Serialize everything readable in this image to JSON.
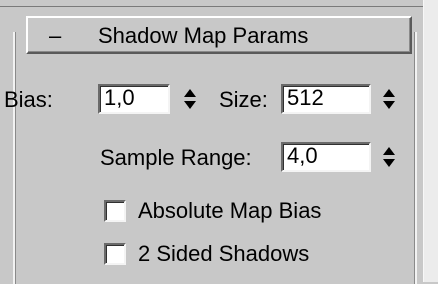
{
  "rollout": {
    "collapse_symbol": "–",
    "title": "Shadow Map Params"
  },
  "bias": {
    "label": "Bias:",
    "value": "1,0"
  },
  "size": {
    "label": "Size:",
    "value": "512"
  },
  "sample_range": {
    "label": "Sample Range:",
    "value": "4,0"
  },
  "checkboxes": [
    {
      "label": "Absolute Map Bias",
      "checked": false
    },
    {
      "label": "2 Sided Shadows",
      "checked": false
    }
  ],
  "icons": {
    "spinner": "spinner-up-down-arrows-icon"
  }
}
